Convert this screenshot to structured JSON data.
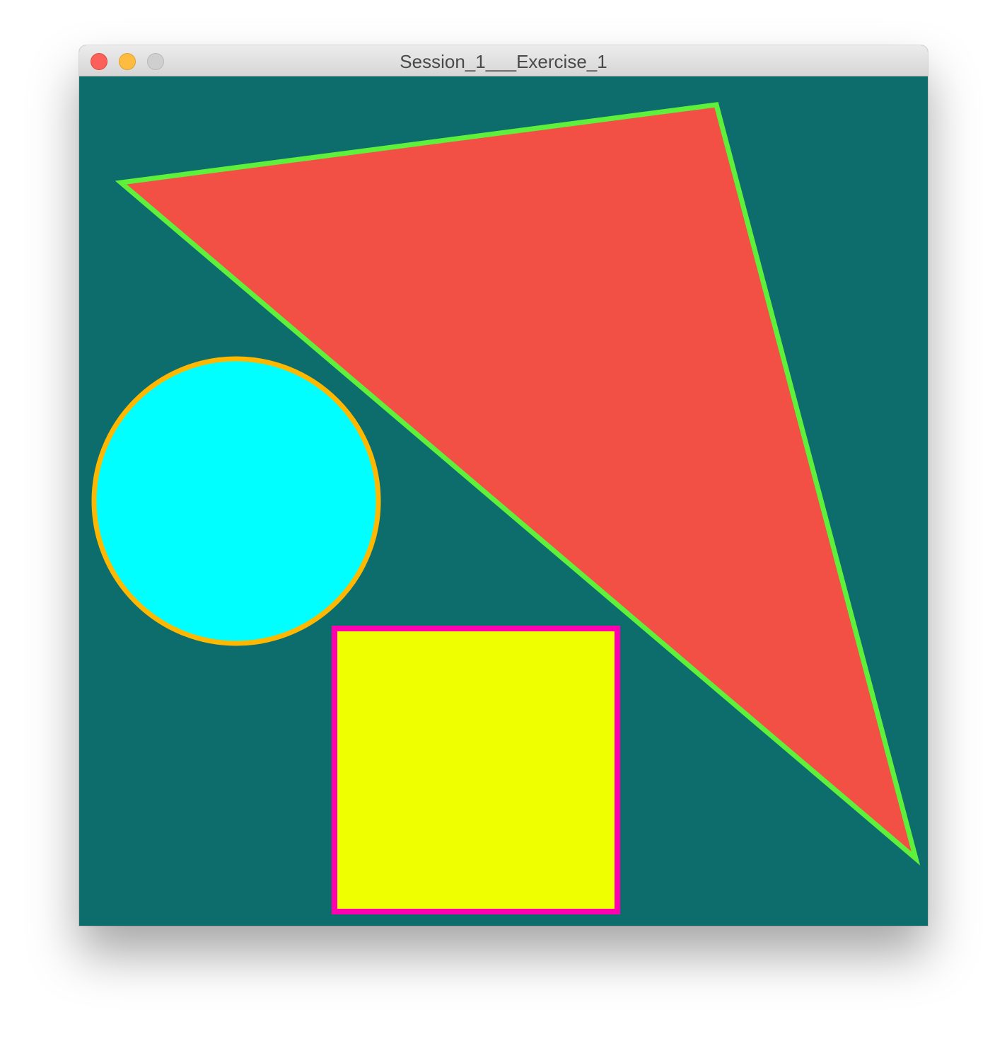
{
  "window": {
    "title": "Session_1___Exercise_1"
  },
  "canvas": {
    "background_color": "#0c6d6c",
    "shapes": [
      {
        "kind": "triangle",
        "fill": "#f35045",
        "stroke": "#5ef03a"
      },
      {
        "kind": "circle",
        "fill": "#00ffff",
        "stroke": "#ffb800"
      },
      {
        "kind": "square",
        "fill": "#f0ff00",
        "stroke": "#ff00b0"
      }
    ]
  }
}
